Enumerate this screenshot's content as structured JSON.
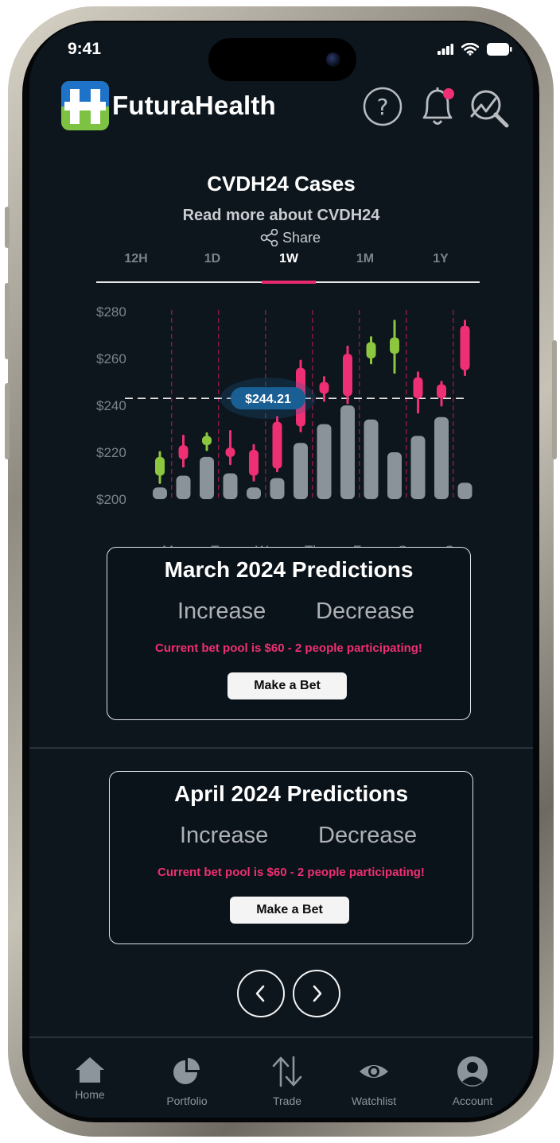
{
  "status_bar": {
    "time": "9:41"
  },
  "header": {
    "brand": "FuturaHealth",
    "brand_colors": {
      "blue": "#1e73c9",
      "green": "#7dc242"
    },
    "notification_color": "#ef2f73"
  },
  "chart_header": {
    "title": "CVDH24 Cases",
    "read_more": "Read more about CVDH24",
    "share_label": "Share"
  },
  "tabs": [
    {
      "label": "12H",
      "active": false
    },
    {
      "label": "1D",
      "active": false
    },
    {
      "label": "1W",
      "active": true
    },
    {
      "label": "1M",
      "active": false
    },
    {
      "label": "1Y",
      "active": false
    }
  ],
  "chart_data": {
    "type": "bar",
    "subtype": "candlestick-with-volume",
    "ylim": [
      200,
      280
    ],
    "yticks": [
      "$200",
      "$220",
      "$240",
      "$260",
      "$280"
    ],
    "day_labels": [
      "Mo",
      "Tu",
      "We",
      "Th",
      "Fr",
      "Sa",
      "Su"
    ],
    "reference_value": 243,
    "reference_label": "$244.21",
    "colors": {
      "up": "#8dc63f",
      "down": "#ef2f73",
      "volume": "#8a929a",
      "reference": "#1a5f93"
    },
    "candles": [
      {
        "color": "up",
        "open": 210,
        "close": 218,
        "low": 207,
        "high": 220
      },
      {
        "color": "down",
        "open": 223,
        "close": 217,
        "low": 214,
        "high": 227
      },
      {
        "color": "up",
        "open": 223,
        "close": 227,
        "low": 221,
        "high": 228
      },
      {
        "color": "down",
        "open": 222,
        "close": 218,
        "low": 215,
        "high": 229
      },
      {
        "color": "down",
        "open": 221,
        "close": 210,
        "low": 208,
        "high": 223
      },
      {
        "color": "down",
        "open": 233,
        "close": 213,
        "low": 212,
        "high": 235
      },
      {
        "color": "down",
        "open": 256,
        "close": 231,
        "low": 229,
        "high": 259
      },
      {
        "color": "down",
        "open": 250,
        "close": 245,
        "low": 242,
        "high": 252
      },
      {
        "color": "down",
        "open": 262,
        "close": 244,
        "low": 241,
        "high": 265
      },
      {
        "color": "up",
        "open": 260,
        "close": 267,
        "low": 258,
        "high": 269
      },
      {
        "color": "up",
        "open": 262,
        "close": 269,
        "low": 254,
        "high": 276
      },
      {
        "color": "down",
        "open": 252,
        "close": 243,
        "low": 237,
        "high": 254
      },
      {
        "color": "down",
        "open": 249,
        "close": 243,
        "low": 240,
        "high": 250
      },
      {
        "color": "down",
        "open": 274,
        "close": 255,
        "low": 253,
        "high": 276
      }
    ],
    "volumes": [
      205,
      210,
      218,
      211,
      205,
      209,
      224,
      232,
      240,
      234,
      220,
      227,
      235,
      207
    ]
  },
  "predictions": [
    {
      "title": "March 2024 Predictions",
      "increase": "Increase",
      "decrease": "Decrease",
      "pool": "Current bet pool is $60 - 2 people participating!",
      "button": "Make a Bet"
    },
    {
      "title": "April 2024 Predictions",
      "increase": "Increase",
      "decrease": "Decrease",
      "pool": "Current bet pool is $60 - 2 people participating!",
      "button": "Make a Bet"
    }
  ],
  "bottom_nav": [
    {
      "label": "Home",
      "icon": "home-icon"
    },
    {
      "label": "Portfolio",
      "icon": "pie-chart-icon"
    },
    {
      "label": "Trade",
      "icon": "trade-arrows-icon"
    },
    {
      "label": "Watchlist",
      "icon": "eye-icon"
    },
    {
      "label": "Account",
      "icon": "user-icon"
    }
  ]
}
